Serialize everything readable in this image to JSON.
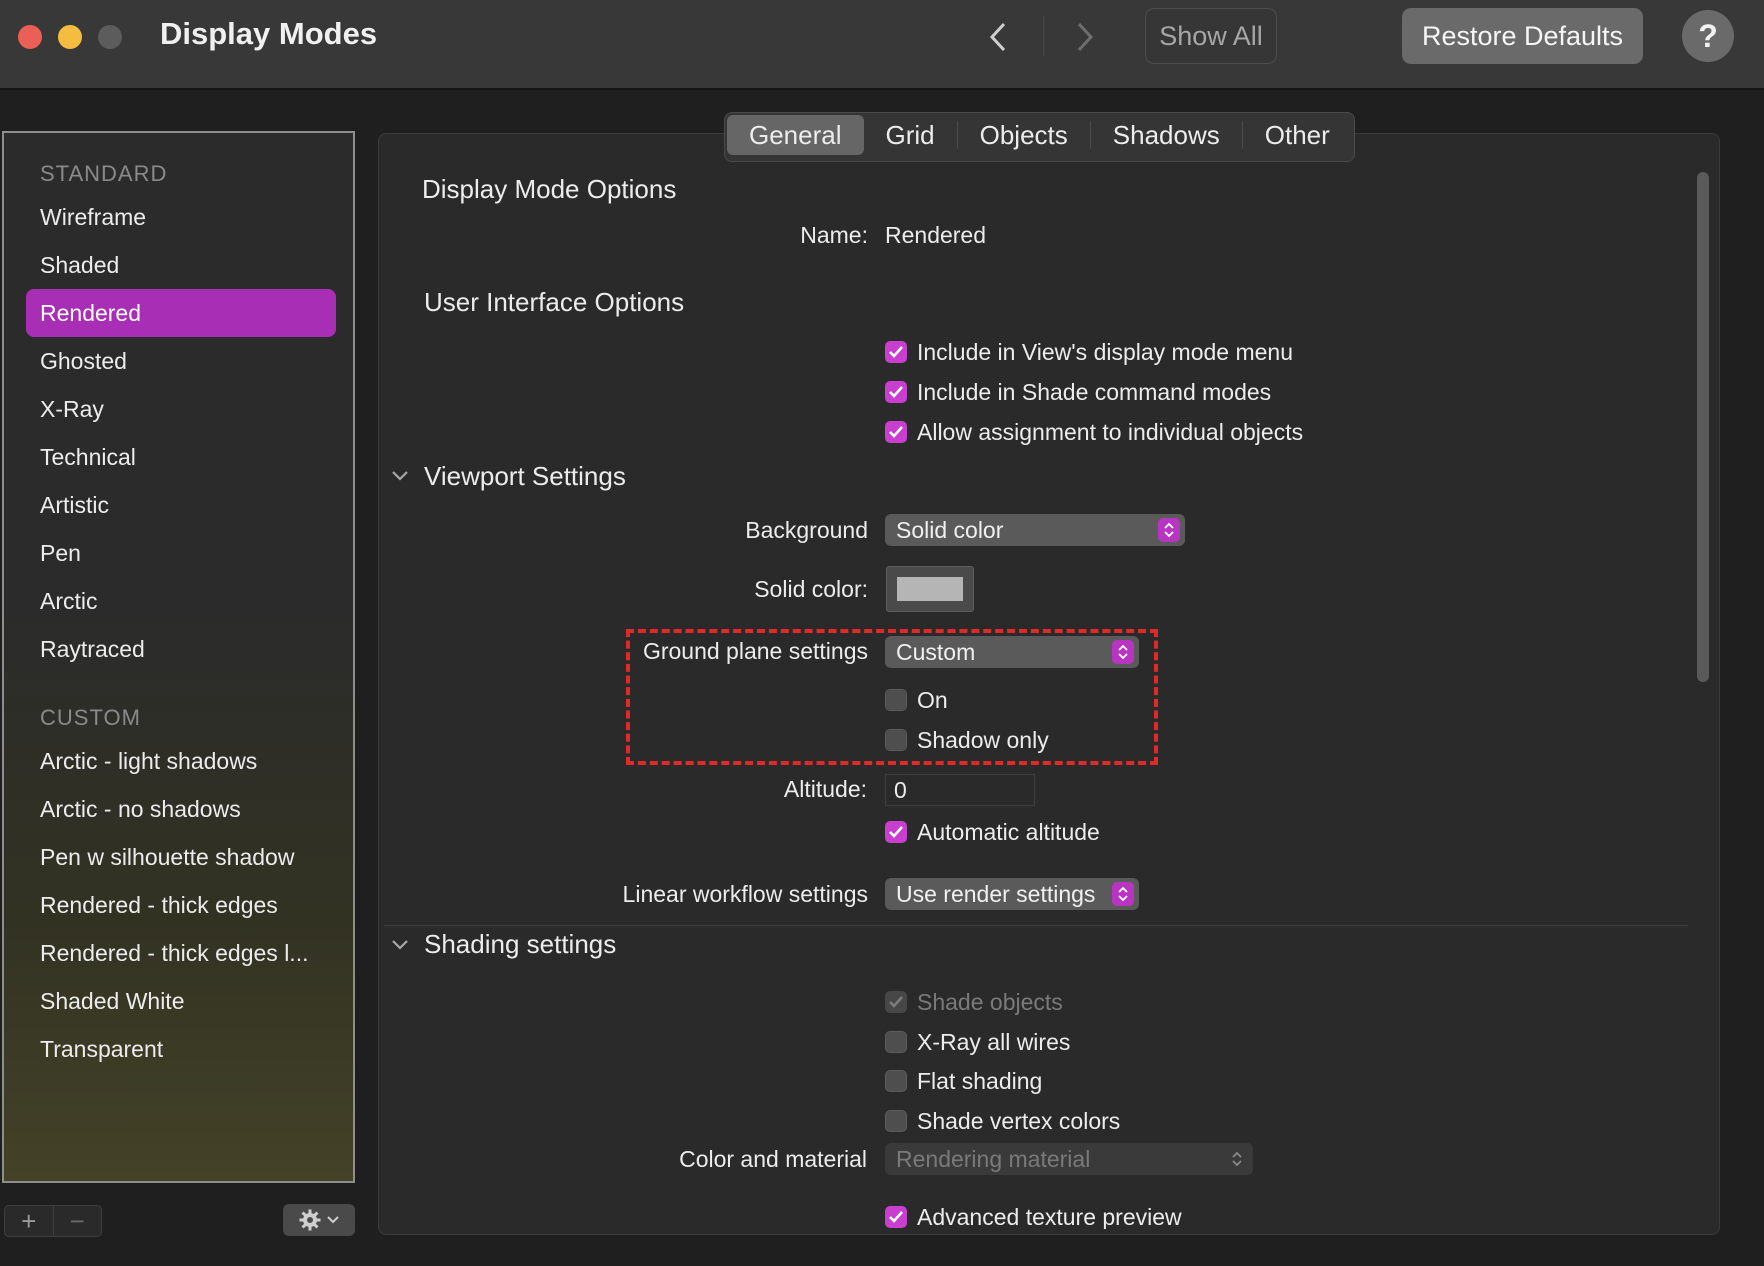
{
  "window": {
    "title": "Display Modes",
    "show_all_label": "Show All",
    "restore_defaults_label": "Restore Defaults",
    "help_label": "?"
  },
  "sidebar": {
    "standard_header": "STANDARD",
    "standard_items": [
      "Wireframe",
      "Shaded",
      "Rendered",
      "Ghosted",
      "X-Ray",
      "Technical",
      "Artistic",
      "Pen",
      "Arctic",
      "Raytraced"
    ],
    "selected_item": "Rendered",
    "custom_header": "CUSTOM",
    "custom_items": [
      "Arctic - light shadows",
      "Arctic - no shadows",
      "Pen w silhouette  shadow",
      "Rendered - thick edges",
      "Rendered - thick edges l...",
      "Shaded White",
      "Transparent"
    ],
    "add_label": "+",
    "remove_label": "−"
  },
  "tabs": [
    "General",
    "Grid",
    "Objects",
    "Shadows",
    "Other"
  ],
  "active_tab": "General",
  "display_mode_options": {
    "title": "Display Mode Options",
    "name_label": "Name:",
    "name_value": "Rendered"
  },
  "ui_options": {
    "title": "User Interface Options",
    "checkboxes": [
      {
        "label": "Include in View's display mode menu",
        "checked": true
      },
      {
        "label": "Include in Shade command modes",
        "checked": true
      },
      {
        "label": "Allow assignment to individual objects",
        "checked": true
      }
    ]
  },
  "viewport": {
    "title": "Viewport Settings",
    "background_label": "Background",
    "background_value": "Solid color",
    "solid_color_label": "Solid color:",
    "solid_color_value": "#b5b5b5",
    "ground_plane_label": "Ground plane settings",
    "ground_plane_value": "Custom",
    "on_label": "On",
    "on_checked": false,
    "shadow_only_label": "Shadow only",
    "shadow_only_checked": false,
    "altitude_label": "Altitude:",
    "altitude_value": "0",
    "auto_altitude_label": "Automatic altitude",
    "auto_altitude_checked": true,
    "linear_workflow_label": "Linear workflow settings",
    "linear_workflow_value": "Use render settings"
  },
  "shading": {
    "title": "Shading settings",
    "shade_objects_label": "Shade objects",
    "xray_label": "X-Ray all wires",
    "flat_shading_label": "Flat shading",
    "vertex_colors_label": "Shade vertex colors",
    "color_material_label": "Color and material",
    "color_material_value": "Rendering material",
    "advanced_texture_label": "Advanced texture preview"
  },
  "colors": {
    "accent": "#a82eb6",
    "checkbox_on": "#c83fd0",
    "highlight_dash": "#e02a2a"
  }
}
